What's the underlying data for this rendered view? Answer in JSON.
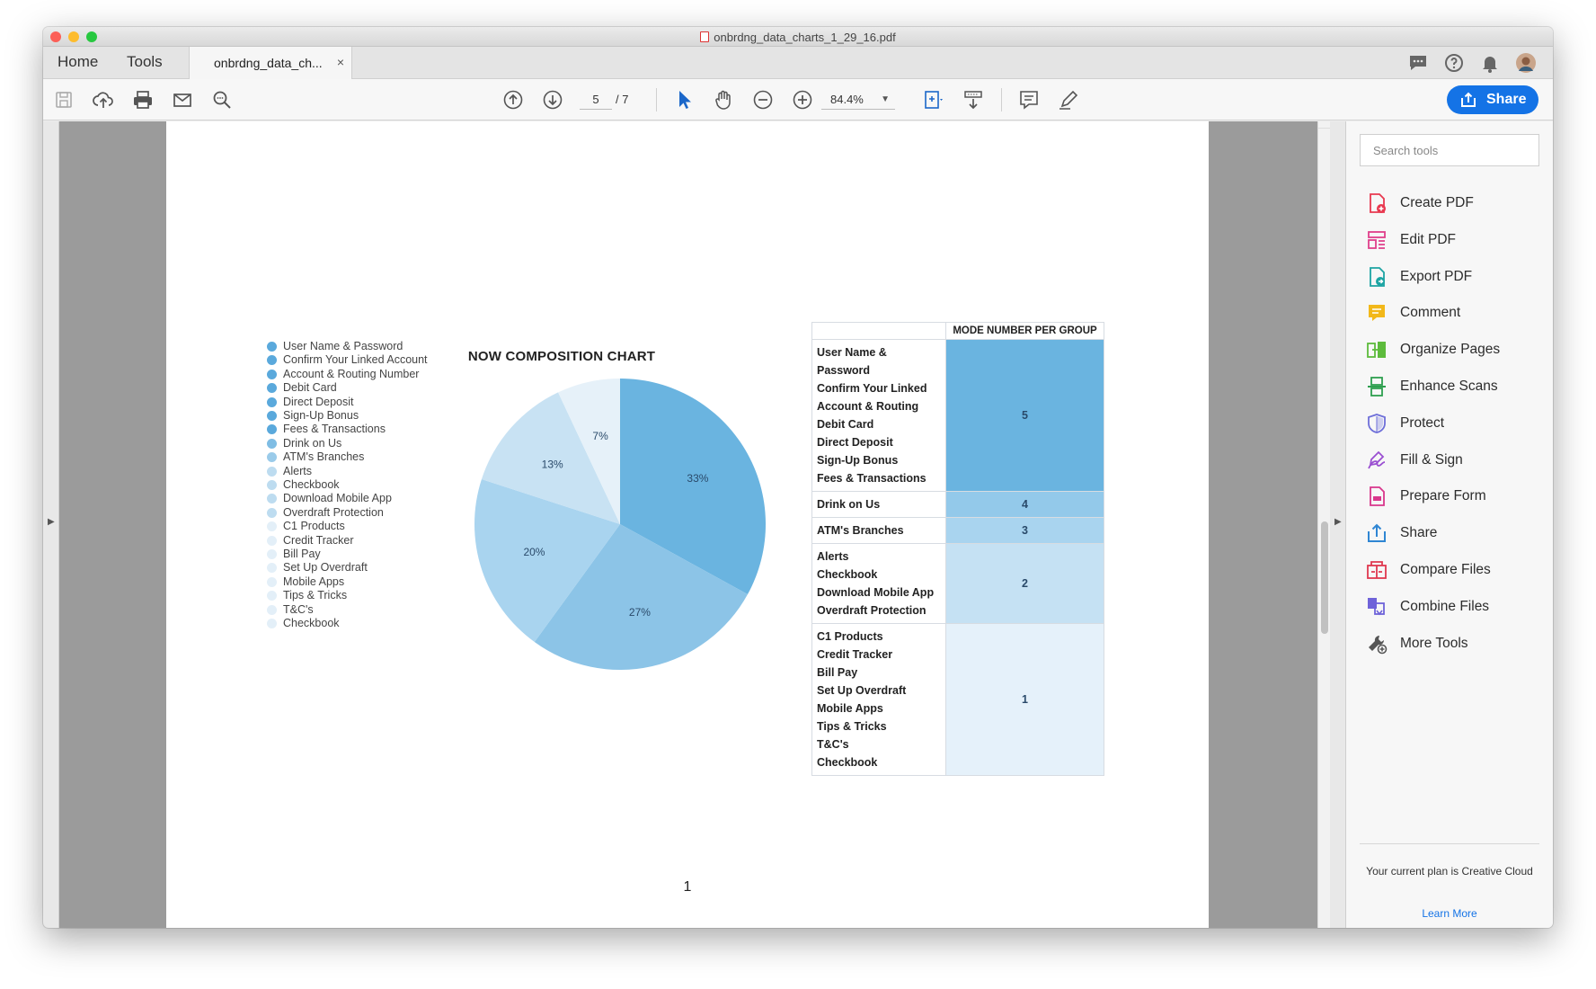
{
  "window": {
    "title": "onbrdng_data_charts_1_29_16.pdf",
    "traffic_lights": [
      "#fc5f57",
      "#fdbc2e",
      "#28c840"
    ]
  },
  "tabs": {
    "home": "Home",
    "tools": "Tools",
    "document": "onbrdng_data_ch...",
    "close": "×"
  },
  "toolbar": {
    "page_current": "5",
    "page_total": "/ 7",
    "zoom": "84.4%",
    "share_label": "Share"
  },
  "tools_pane": {
    "search_placeholder": "Search tools",
    "items": [
      {
        "label": "Create PDF",
        "icon": "create-pdf-icon",
        "color": "#e8384f"
      },
      {
        "label": "Edit PDF",
        "icon": "edit-pdf-icon",
        "color": "#e03f8b"
      },
      {
        "label": "Export PDF",
        "icon": "export-pdf-icon",
        "color": "#1da4a3"
      },
      {
        "label": "Comment",
        "icon": "comment-icon",
        "color": "#f2b81a"
      },
      {
        "label": "Organize Pages",
        "icon": "organize-pages-icon",
        "color": "#5dbb3c"
      },
      {
        "label": "Enhance Scans",
        "icon": "enhance-scans-icon",
        "color": "#2e9f4f"
      },
      {
        "label": "Protect",
        "icon": "protect-icon",
        "color": "#6e6fd9"
      },
      {
        "label": "Fill & Sign",
        "icon": "fill-sign-icon",
        "color": "#9a4fd1"
      },
      {
        "label": "Prepare Form",
        "icon": "prepare-form-icon",
        "color": "#d9378c"
      },
      {
        "label": "Share",
        "icon": "share-icon",
        "color": "#2f86d3"
      },
      {
        "label": "Compare Files",
        "icon": "compare-files-icon",
        "color": "#e0384f"
      },
      {
        "label": "Combine Files",
        "icon": "combine-files-icon",
        "color": "#6f63d9"
      },
      {
        "label": "More Tools",
        "icon": "more-tools-icon",
        "color": "#555555"
      }
    ],
    "plan_text": "Your current plan is Creative Cloud",
    "learn_more": "Learn More"
  },
  "document": {
    "chart_title": "NOW COMPOSITION CHART",
    "page_number": "1",
    "legend": [
      {
        "label": "User Name & Password",
        "color": "#5aa9dc"
      },
      {
        "label": "Confirm Your Linked Account",
        "color": "#5aa9dc"
      },
      {
        "label": "Account & Routing Number",
        "color": "#5aa9dc"
      },
      {
        "label": "Debit Card",
        "color": "#5aa9dc"
      },
      {
        "label": "Direct Deposit",
        "color": "#5aa9dc"
      },
      {
        "label": " Sign-Up Bonus",
        "color": "#5aa9dc"
      },
      {
        "label": "Fees & Transactions",
        "color": "#5aa9dc"
      },
      {
        "label": " Drink on Us",
        "color": "#7fbde4"
      },
      {
        "label": "ATM's Branches",
        "color": "#9acbea"
      },
      {
        "label": "Alerts",
        "color": "#bddcf0"
      },
      {
        "label": "Checkbook",
        "color": "#bddcf0"
      },
      {
        "label": "Download Mobile App",
        "color": "#bddcf0"
      },
      {
        "label": "Overdraft Protection",
        "color": "#bddcf0"
      },
      {
        "label": "C1 Products",
        "color": "#e3eff8"
      },
      {
        "label": "Credit Tracker",
        "color": "#e3eff8"
      },
      {
        "label": "Bill Pay",
        "color": "#e3eff8"
      },
      {
        "label": "Set Up Overdraft",
        "color": "#e3eff8"
      },
      {
        "label": "Mobile Apps",
        "color": "#e3eff8"
      },
      {
        "label": "Tips & Tricks",
        "color": "#e3eff8"
      },
      {
        "label": "T&C's",
        "color": "#e3eff8"
      },
      {
        "label": "Checkbook",
        "color": "#e3eff8"
      }
    ],
    "table": {
      "header": "MODE NUMBER PER GROUP",
      "groups": [
        {
          "names": [
            "User Name & Password",
            "Confirm Your Linked",
            "Account & Routing",
            "Debit Card",
            "Direct Deposit",
            "Sign-Up Bonus",
            "Fees & Transactions"
          ],
          "value": "5",
          "color": "#6ab4e0"
        },
        {
          "names": [
            "Drink on Us"
          ],
          "value": "4",
          "color": "#93c9ea"
        },
        {
          "names": [
            "ATM's Branches"
          ],
          "value": "3",
          "color": "#a9d4ef"
        },
        {
          "names": [
            "Alerts",
            "Checkbook",
            "Download Mobile App",
            "Overdraft Protection"
          ],
          "value": "2",
          "color": "#c5e1f3"
        },
        {
          "names": [
            "C1 Products",
            "Credit Tracker",
            "Bill Pay",
            "Set Up Overdraft",
            "Mobile Apps",
            "Tips & Tricks",
            "T&C's",
            "Checkbook"
          ],
          "value": "1",
          "color": "#e5f1fa"
        }
      ]
    }
  },
  "chart_data": {
    "type": "pie",
    "title": "NOW COMPOSITION CHART",
    "slices": [
      {
        "label": "33%",
        "value": 33,
        "color": "#6ab4e0"
      },
      {
        "label": "27%",
        "value": 27,
        "color": "#8cc4e7"
      },
      {
        "label": "20%",
        "value": 20,
        "color": "#a9d4ef"
      },
      {
        "label": "13%",
        "value": 13,
        "color": "#c8e2f3"
      },
      {
        "label": "7%",
        "value": 7,
        "color": "#e6f1f9"
      }
    ]
  }
}
